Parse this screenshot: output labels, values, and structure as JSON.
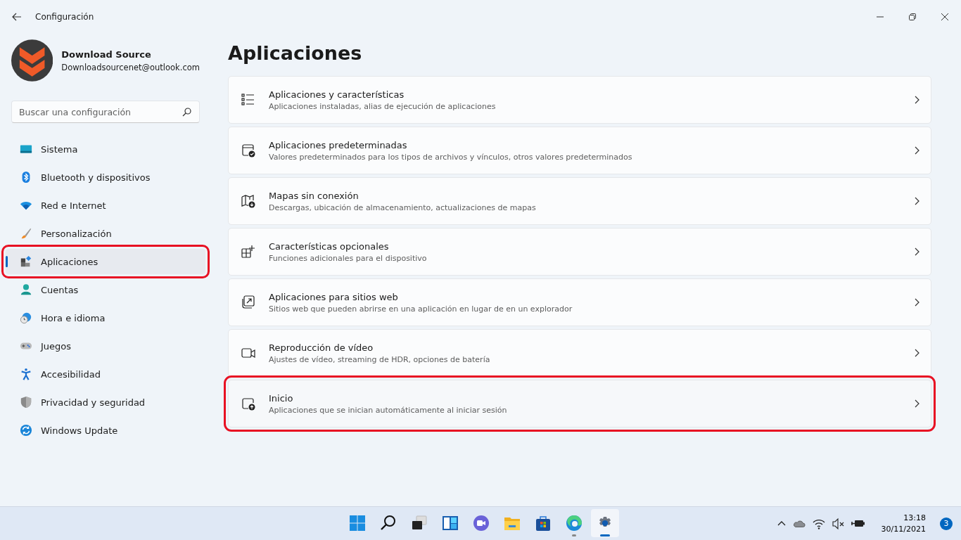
{
  "window": {
    "title": "Configuración"
  },
  "profile": {
    "name": "Download Source",
    "email": "Downloadsourcenet@outlook.com"
  },
  "search": {
    "placeholder": "Buscar una configuración"
  },
  "sidebar": {
    "items": [
      {
        "label": "Sistema",
        "selected": false,
        "highlighted": false
      },
      {
        "label": "Bluetooth y dispositivos",
        "selected": false,
        "highlighted": false
      },
      {
        "label": "Red e Internet",
        "selected": false,
        "highlighted": false
      },
      {
        "label": "Personalización",
        "selected": false,
        "highlighted": false
      },
      {
        "label": "Aplicaciones",
        "selected": true,
        "highlighted": true
      },
      {
        "label": "Cuentas",
        "selected": false,
        "highlighted": false
      },
      {
        "label": "Hora e idioma",
        "selected": false,
        "highlighted": false
      },
      {
        "label": "Juegos",
        "selected": false,
        "highlighted": false
      },
      {
        "label": "Accesibilidad",
        "selected": false,
        "highlighted": false
      },
      {
        "label": "Privacidad y seguridad",
        "selected": false,
        "highlighted": false
      },
      {
        "label": "Windows Update",
        "selected": false,
        "highlighted": false
      }
    ]
  },
  "page": {
    "title": "Aplicaciones",
    "cards": [
      {
        "title": "Aplicaciones y características",
        "description": "Aplicaciones instaladas, alias de ejecución de aplicaciones",
        "highlighted": false
      },
      {
        "title": "Aplicaciones predeterminadas",
        "description": "Valores predeterminados para los tipos de archivos y vínculos, otros valores predeterminados",
        "highlighted": false
      },
      {
        "title": "Mapas sin conexión",
        "description": "Descargas, ubicación de almacenamiento, actualizaciones de mapas",
        "highlighted": false
      },
      {
        "title": "Características opcionales",
        "description": "Funciones adicionales para el dispositivo",
        "highlighted": false
      },
      {
        "title": "Aplicaciones para sitios web",
        "description": "Sitios web que pueden abrirse en una aplicación en lugar de en un explorador",
        "highlighted": false
      },
      {
        "title": "Reproducción de vídeo",
        "description": "Ajustes de vídeo, streaming de HDR, opciones de batería",
        "highlighted": false
      },
      {
        "title": "Inicio",
        "description": "Aplicaciones que se inician automáticamente al iniciar sesión",
        "highlighted": true
      }
    ]
  },
  "taskbar": {
    "apps": [
      {
        "running": false,
        "active": false
      },
      {
        "running": false,
        "active": false
      },
      {
        "running": false,
        "active": false
      },
      {
        "running": false,
        "active": false
      },
      {
        "running": false,
        "active": false
      },
      {
        "running": false,
        "active": false
      },
      {
        "running": false,
        "active": false
      },
      {
        "running": true,
        "active": false
      },
      {
        "running": true,
        "active": true
      }
    ]
  },
  "tray": {
    "time": "13:18",
    "date": "30/11/2021",
    "notifications": "3"
  }
}
